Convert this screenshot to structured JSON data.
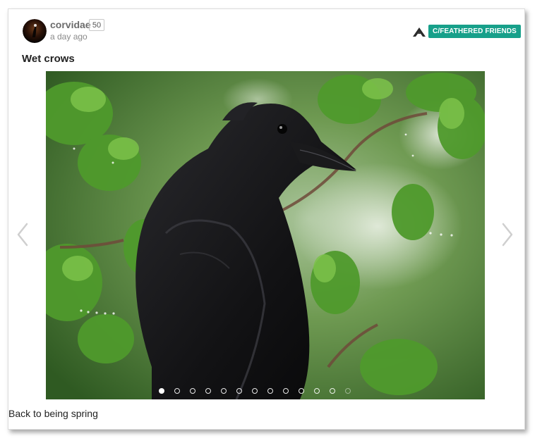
{
  "post": {
    "author": "corvidae",
    "score": "50",
    "timestamp": "a day ago",
    "community": "C/FEATHERED FRIENDS",
    "title": "Wet crows",
    "caption": "Back to being spring"
  },
  "carousel": {
    "slide_count": 13,
    "active_index": 0
  },
  "colors": {
    "badge": "#17a08a",
    "username": "#6b6b6b"
  },
  "icons": {
    "community_logo": "mountain-logo-icon",
    "prev": "chevron-left-icon",
    "next": "chevron-right-icon"
  }
}
